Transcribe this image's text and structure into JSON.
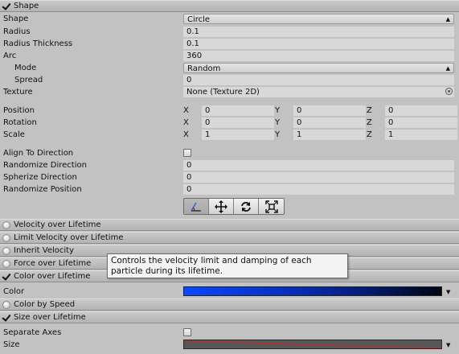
{
  "shape_module": {
    "header": "Shape",
    "shape": {
      "label": "Shape",
      "value": "Circle"
    },
    "radius": {
      "label": "Radius",
      "value": "0.1"
    },
    "radius_thickness": {
      "label": "Radius Thickness",
      "value": "0.1"
    },
    "arc": {
      "label": "Arc",
      "value": "360"
    },
    "mode": {
      "label": "Mode",
      "value": "Random"
    },
    "spread": {
      "label": "Spread",
      "value": "0"
    },
    "texture": {
      "label": "Texture",
      "value": "None (Texture 2D)"
    },
    "position": {
      "label": "Position",
      "x": "0",
      "y": "0",
      "z": "0"
    },
    "rotation": {
      "label": "Rotation",
      "x": "0",
      "y": "0",
      "z": "0"
    },
    "scale": {
      "label": "Scale",
      "x": "1",
      "y": "1",
      "z": "1"
    },
    "axis_labels": {
      "x": "X",
      "y": "Y",
      "z": "Z"
    },
    "align_to_direction": {
      "label": "Align To Direction",
      "checked": false
    },
    "randomize_direction": {
      "label": "Randomize Direction",
      "value": "0"
    },
    "spherize_direction": {
      "label": "Spherize Direction",
      "value": "0"
    },
    "randomize_position": {
      "label": "Randomize Position",
      "value": "0"
    },
    "tools": [
      "edit-shape-icon",
      "move-icon",
      "rotate-icon",
      "scale-icon"
    ]
  },
  "modules": [
    {
      "title": "Velocity over Lifetime",
      "enabled": false
    },
    {
      "title": "Limit Velocity over Lifetime",
      "enabled": false
    },
    {
      "title": "Inherit Velocity",
      "enabled": false
    },
    {
      "title": "Force over Lifetime",
      "enabled": false
    },
    {
      "title": "Color over Lifetime",
      "enabled": true
    },
    {
      "title": "Color by Speed",
      "enabled": false
    },
    {
      "title": "Size over Lifetime",
      "enabled": true
    }
  ],
  "color_over_lifetime": {
    "label": "Color",
    "gradient_colors": [
      "#0b48ff",
      "#010515"
    ]
  },
  "size_over_lifetime": {
    "separate_axes": {
      "label": "Separate Axes",
      "checked": false
    },
    "size": {
      "label": "Size"
    }
  },
  "tooltip": "Controls the velocity limit and damping of each particle during its lifetime.",
  "colors": {
    "panel": "#c2c2c2",
    "field": "#d8d8d8",
    "curve": "#d22020"
  }
}
